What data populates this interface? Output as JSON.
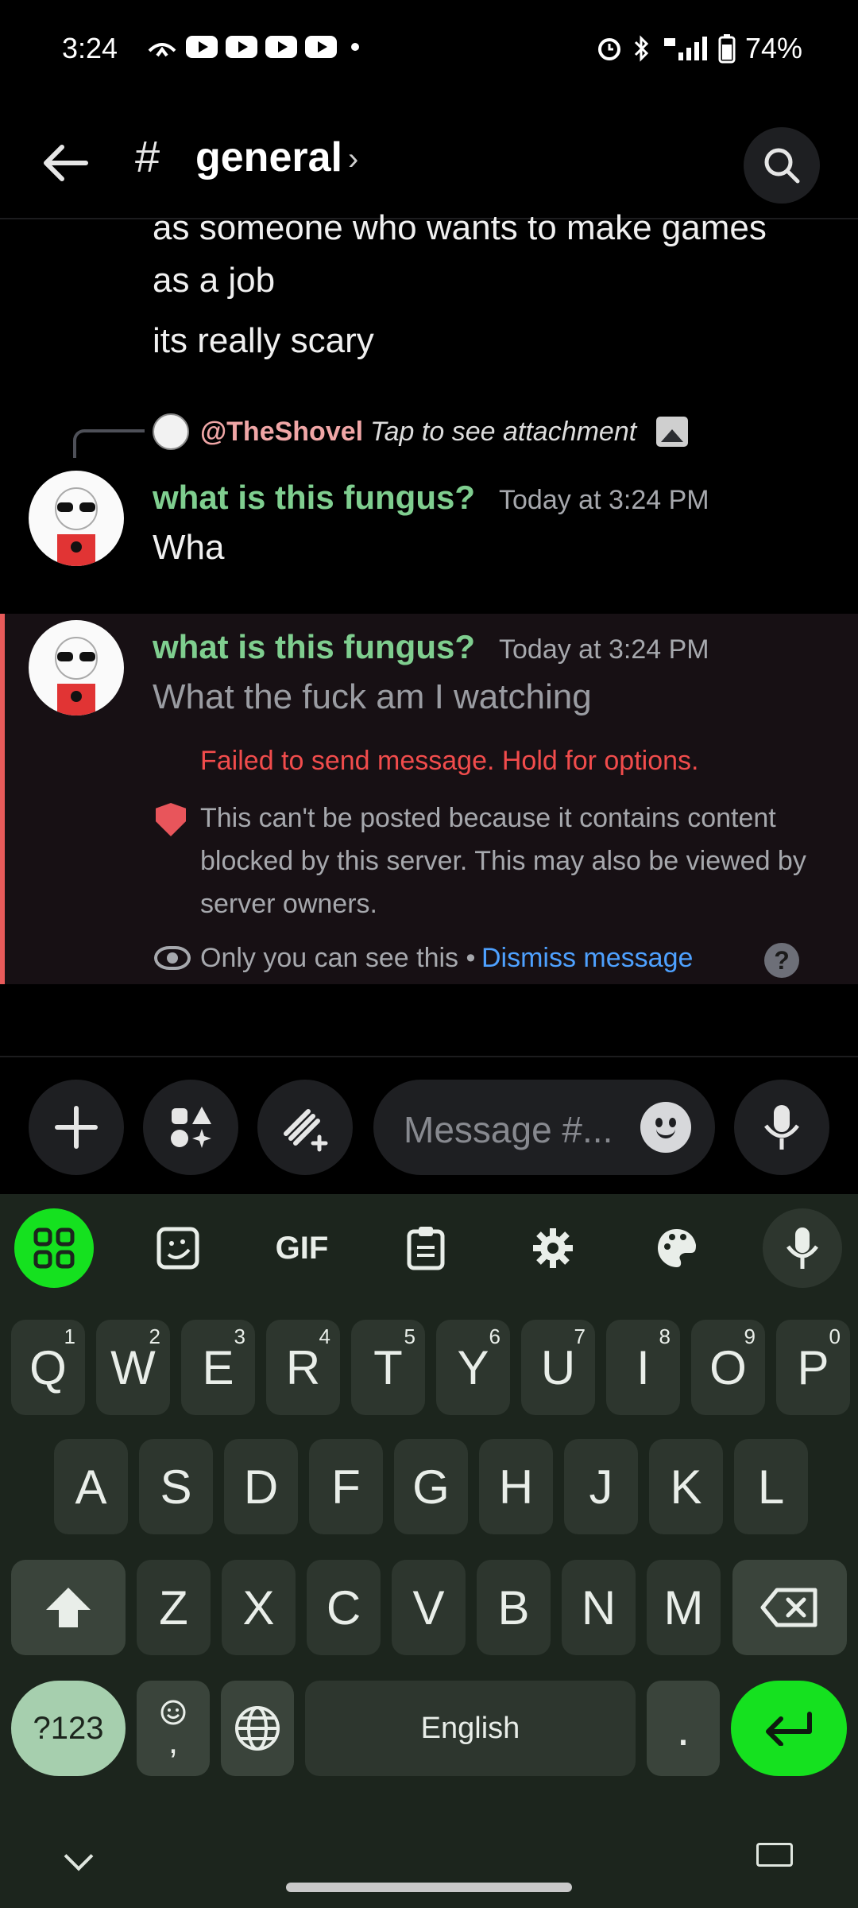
{
  "status_bar": {
    "time": "3:24",
    "battery": "74%"
  },
  "header": {
    "hash": "#",
    "channel": "general",
    "chevron": "›"
  },
  "earlier_message": {
    "lines": [
      "as someone who wants to make games",
      "as a job",
      "its really scary"
    ]
  },
  "reply": {
    "user": "@TheShovel",
    "attachment_text": "Tap to see attachment"
  },
  "messages": [
    {
      "author": "what is this fungus?",
      "timestamp": "Today at 3:24 PM",
      "text": "Wha"
    },
    {
      "author": "what is this fungus?",
      "timestamp": "Today at 3:24 PM",
      "text": "What the fuck am I watching"
    }
  ],
  "failed_notice": {
    "error": "Failed to send message. Hold for options.",
    "reason": "This can't be posted because it contains content blocked by this server. This may also be viewed by server owners.",
    "visibility": "Only you can see this •",
    "dismiss": "Dismiss message",
    "help": "?"
  },
  "composer": {
    "placeholder": "Message #..."
  },
  "keyboard": {
    "toolbar": {
      "gif": "GIF"
    },
    "row1": [
      {
        "k": "Q",
        "h": "1"
      },
      {
        "k": "W",
        "h": "2"
      },
      {
        "k": "E",
        "h": "3"
      },
      {
        "k": "R",
        "h": "4"
      },
      {
        "k": "T",
        "h": "5"
      },
      {
        "k": "Y",
        "h": "6"
      },
      {
        "k": "U",
        "h": "7"
      },
      {
        "k": "I",
        "h": "8"
      },
      {
        "k": "O",
        "h": "9"
      },
      {
        "k": "P",
        "h": "0"
      }
    ],
    "row2": [
      "A",
      "S",
      "D",
      "F",
      "G",
      "H",
      "J",
      "K",
      "L"
    ],
    "row3": [
      "Z",
      "X",
      "C",
      "V",
      "B",
      "N",
      "M"
    ],
    "num_key": "?123",
    "comma": ",",
    "space": "English",
    "period": "."
  }
}
